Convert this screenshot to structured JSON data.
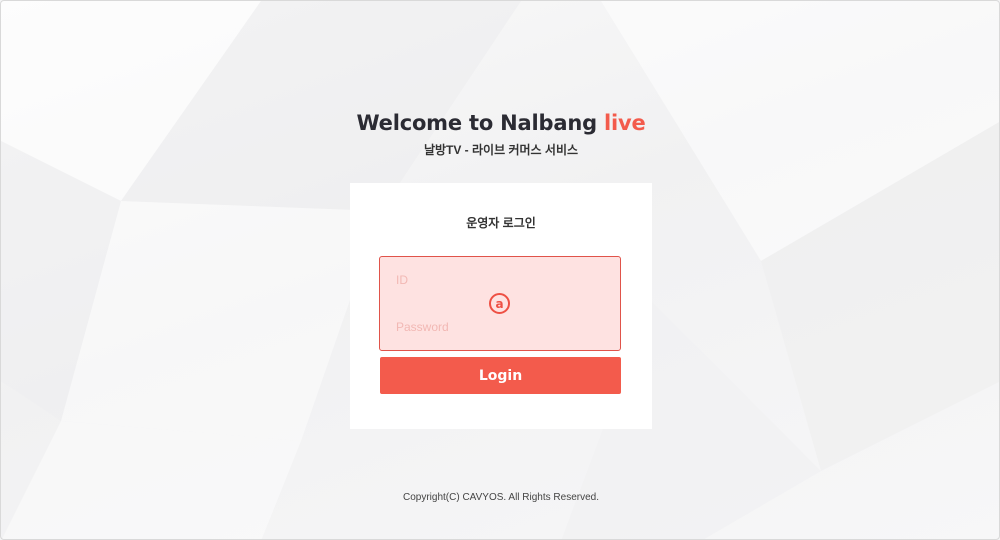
{
  "header": {
    "title_main": "Welcome to Nalbang ",
    "title_accent": "live",
    "subtitle": "날방TV - 라이브 커머스 서비스"
  },
  "login": {
    "card_title": "운영자 로그인",
    "id_placeholder": "ID",
    "password_placeholder": "Password",
    "badge_glyph": "a",
    "login_label": "Login"
  },
  "footer": {
    "copyright": "Copyright(C) CAVYOS. All Rights Reserved."
  },
  "colors": {
    "accent": "#f35b4c",
    "input_bg": "#fee2e1",
    "background": "#f4f4f5"
  }
}
